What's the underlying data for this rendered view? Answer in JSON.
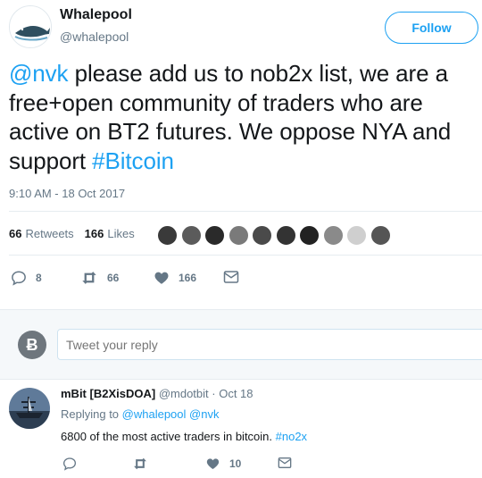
{
  "account": {
    "name": "Whalepool",
    "handle": "@whalepool",
    "follow_label": "Follow"
  },
  "tweet": {
    "mention": "@nvk",
    "text_body": " please add us to nob2x list, we are a free+open community of traders who are active on BT2 futures. We oppose NYA and support ",
    "hashtag": "#Bitcoin",
    "timestamp": "9:10 AM - 18 Oct 2017",
    "retweets_count": "66",
    "retweets_label": "Retweets",
    "likes_count": "166",
    "likes_label": "Likes"
  },
  "actions": {
    "reply_count": "8",
    "retweet_count": "66",
    "like_count": "166"
  },
  "reply_box": {
    "avatar_glyph": "Ƀ",
    "placeholder": "Tweet your reply"
  },
  "reply": {
    "name": "mBit [B2XisDOA]",
    "handle": "@mdotbit",
    "separator": " · ",
    "date": "Oct 18",
    "replying_prefix": "Replying to ",
    "replying_to_1": "@whalepool",
    "replying_to_2": "@nvk",
    "text": "6800 of the most active traders in bitcoin. ",
    "hashtag": "#no2x",
    "like_count": "10"
  },
  "colors": {
    "accent": "#1da1f2",
    "muted": "#657786",
    "text": "#14171a"
  }
}
